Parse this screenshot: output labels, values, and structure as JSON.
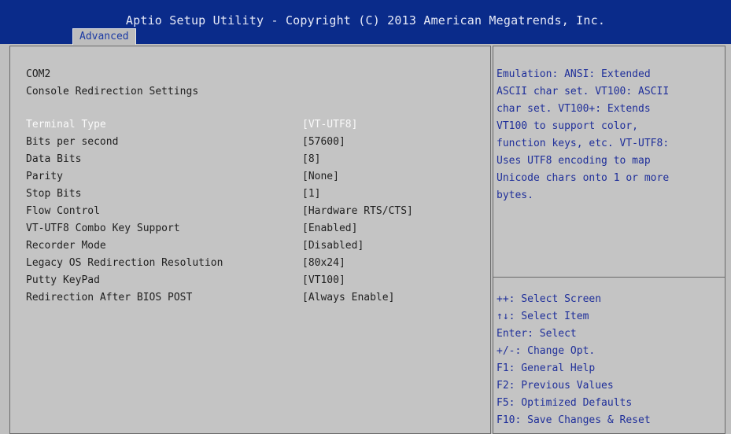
{
  "header": {
    "title": "Aptio Setup Utility - Copyright (C) 2013 American Megatrends, Inc.",
    "tab": "Advanced"
  },
  "main": {
    "section": "COM2",
    "subtitle": "Console Redirection Settings",
    "settings": [
      {
        "label": "Terminal Type",
        "value": "[VT-UTF8]"
      },
      {
        "label": "Bits per second",
        "value": "[57600]"
      },
      {
        "label": "Data Bits",
        "value": "[8]"
      },
      {
        "label": "Parity",
        "value": "[None]"
      },
      {
        "label": "Stop Bits",
        "value": "[1]"
      },
      {
        "label": "Flow Control",
        "value": "[Hardware RTS/CTS]"
      },
      {
        "label": "VT-UTF8 Combo Key Support",
        "value": "[Enabled]"
      },
      {
        "label": "Recorder Mode",
        "value": "[Disabled]"
      },
      {
        "label": "Legacy OS Redirection Resolution",
        "value": "[80x24]"
      },
      {
        "label": "Putty KeyPad",
        "value": "[VT100]"
      },
      {
        "label": "Redirection After BIOS POST",
        "value": "[Always Enable]"
      }
    ]
  },
  "help": {
    "lines": [
      "Emulation: ANSI: Extended",
      "ASCII char set. VT100: ASCII",
      "char set. VT100+: Extends",
      "VT100 to support color,",
      "function keys, etc. VT-UTF8:",
      "Uses UTF8 encoding to map",
      "Unicode chars onto 1 or more",
      "bytes."
    ]
  },
  "keys": {
    "lines": [
      "++: Select Screen",
      "↑↓: Select Item",
      "Enter: Select",
      "+/-: Change Opt.",
      "F1: General Help",
      "F2: Previous Values",
      "F5: Optimized Defaults",
      "F10: Save Changes & Reset"
    ]
  }
}
